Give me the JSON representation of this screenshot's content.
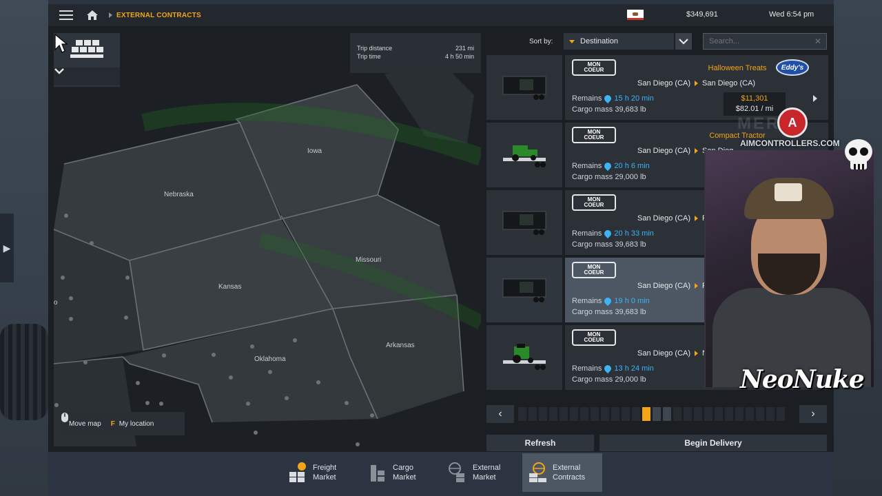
{
  "topbar": {
    "breadcrumb": "EXTERNAL CONTRACTS",
    "money": "$349,691",
    "clock": "Wed 6:54 pm"
  },
  "map": {
    "trip_distance_label": "Trip distance",
    "trip_distance_value": "231 mi",
    "trip_time_label": "Trip time",
    "trip_time_value": "4 h 50 min",
    "states": [
      "Iowa",
      "Nebraska",
      "Missouri",
      "Kansas",
      "Arkansas",
      "Oklahoma"
    ],
    "edge_label": "o",
    "controls": {
      "move_map": "Move map",
      "location_key": "F",
      "my_location": "My location"
    }
  },
  "sort": {
    "label": "Sort by:",
    "value": "Destination",
    "search_placeholder": "Search..."
  },
  "company": {
    "logo_line1": "MON",
    "logo_line2": "COEUR"
  },
  "jobs": [
    {
      "cargo": "Halloween Treats",
      "from": "San Diego (CA)",
      "to": "San Diego (CA)",
      "remains": "15 h 20 min",
      "mass": "39,683 lb",
      "price": "$11,301",
      "rate": "$82.01 / mi",
      "client": "Eddy's"
    },
    {
      "cargo": "Compact Tractor",
      "from": "San Diego (CA)",
      "to": "San Dieg",
      "remains": "20 h 6 min",
      "mass": "29,000 lb"
    },
    {
      "cargo": "Halloween T",
      "from": "San Diego (CA)",
      "to": "F",
      "remains": "20 h 33 min",
      "mass": "39,683 lb"
    },
    {
      "cargo": "Halloween T",
      "from": "San Diego (CA)",
      "to": "F",
      "remains": "19 h 0 min",
      "mass": "39,683 lb"
    },
    {
      "cargo": "Tracto",
      "from": "San Diego (CA)",
      "to": "N",
      "remains": "13 h 24 min",
      "mass": "29,000 lb"
    }
  ],
  "job_labels": {
    "remains": "Remains",
    "mass": "Cargo mass"
  },
  "pager": {
    "total": 26,
    "active": 12
  },
  "actions": {
    "refresh": "Refresh",
    "begin": "Begin Delivery"
  },
  "bottom_nav": [
    {
      "line1": "Freight",
      "line2": "Market"
    },
    {
      "line1": "Cargo",
      "line2": "Market"
    },
    {
      "line1": "External",
      "line2": "Market"
    },
    {
      "line1": "External",
      "line2": "Contracts"
    }
  ],
  "overlay": {
    "streamer": "NeoNuke",
    "sponsor_text": "AIMCONTROLLERS.COM",
    "sponsor_logo": "A",
    "watermark": "MER"
  },
  "colors": {
    "accent": "#f2a516",
    "time": "#3eb3f5",
    "selected": "#4d5763"
  }
}
